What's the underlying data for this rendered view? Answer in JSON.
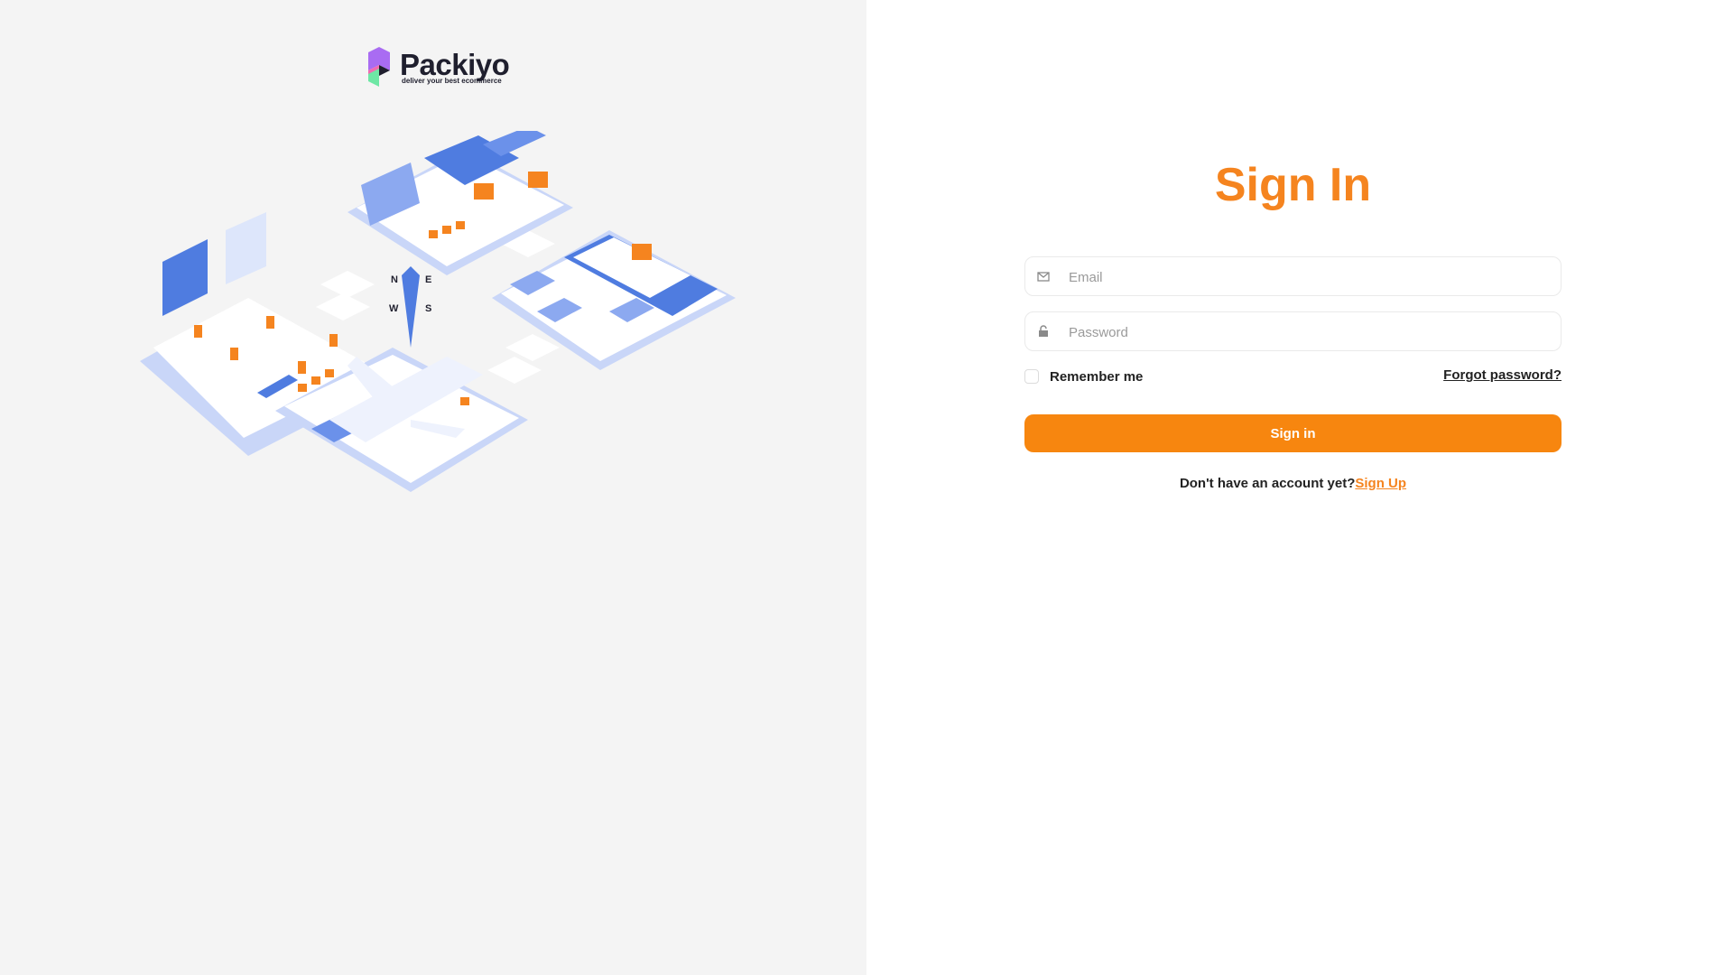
{
  "brand": {
    "name": "Packiyo",
    "tagline": "deliver your best ecommerce",
    "colors": {
      "accent": "#f5841f",
      "logo_purple": "#a96cf2",
      "logo_green": "#6ee7a5"
    }
  },
  "illustration": {
    "icon": "isometric-logistics-illustration",
    "compass": [
      "N",
      "E",
      "W",
      "S"
    ]
  },
  "form": {
    "title": "Sign In",
    "email": {
      "placeholder": "Email",
      "value": "",
      "icon": "envelope-icon"
    },
    "password": {
      "placeholder": "Password",
      "value": "",
      "icon": "lock-icon"
    },
    "remember_label": "Remember me",
    "remember_checked": false,
    "forgot_label": "Forgot password?",
    "submit_label": "Sign in",
    "signup_prompt": "Don't have an account yet?",
    "signup_link": "Sign Up"
  }
}
